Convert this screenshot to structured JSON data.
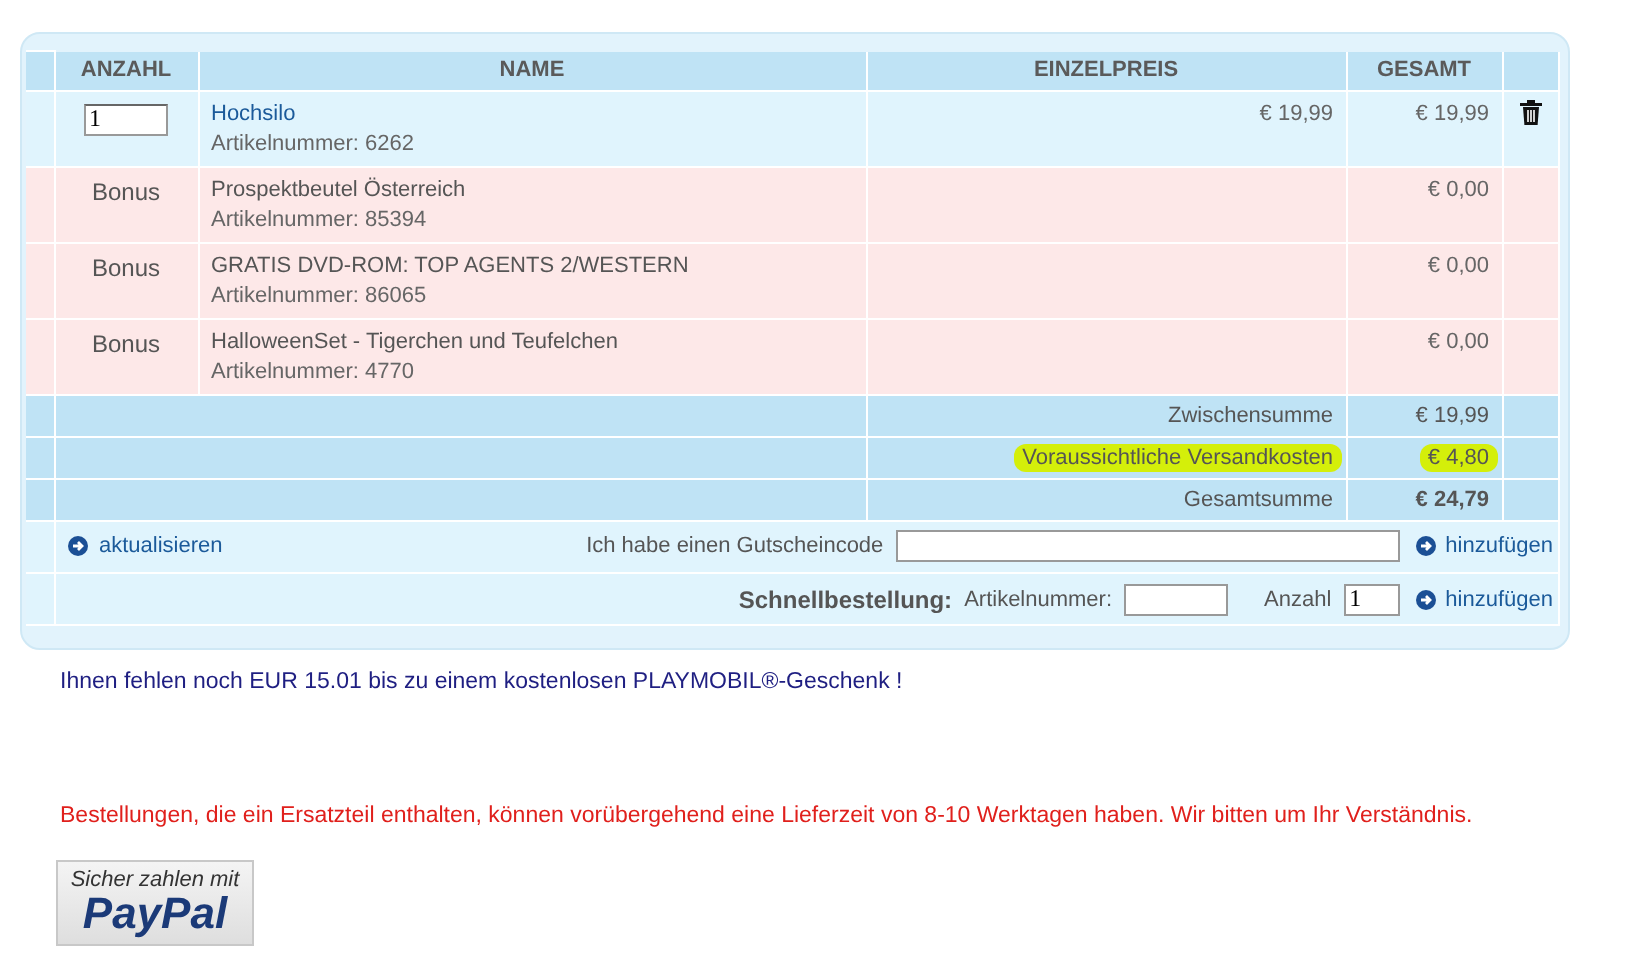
{
  "columns": [
    {
      "label": "ANZAHL"
    },
    {
      "label": "NAME"
    },
    {
      "label": "EINZELPREIS"
    },
    {
      "label": "GESAMT"
    }
  ],
  "items": [
    {
      "kind": "product",
      "quantity": "1",
      "name": "Hochsilo",
      "article": "Artikelnummer: 6262",
      "unit_price": "€ 19,99",
      "total": "€ 19,99"
    },
    {
      "kind": "bonus",
      "label": "Bonus",
      "name": "Prospektbeutel Österreich",
      "article": "Artikelnummer: 85394",
      "total": "€ 0,00"
    },
    {
      "kind": "bonus",
      "label": "Bonus",
      "name": "GRATIS DVD-ROM: TOP AGENTS 2/WESTERN",
      "article": "Artikelnummer: 86065",
      "total": "€ 0,00"
    },
    {
      "kind": "bonus",
      "label": "Bonus",
      "name": "HalloweenSet - Tigerchen und Teufelchen",
      "article": "Artikelnummer: 4770",
      "total": "€ 0,00"
    }
  ],
  "summary": [
    {
      "label": "Zwischensumme",
      "value": "€ 19,99",
      "highlighted": false,
      "emphasized": false
    },
    {
      "label": "Voraussichtliche Versandkosten",
      "value": "€ 4,80",
      "highlighted": true,
      "emphasized": false
    },
    {
      "label": "Gesamtsumme",
      "value": "€ 24,79",
      "highlighted": false,
      "emphasized": true
    }
  ],
  "update_link": "aktualisieren",
  "voucher": {
    "label": "Ich habe einen Gutscheincode",
    "add_link": "hinzufügen"
  },
  "quick_order": {
    "title": "Schnellbestellung:",
    "article_label": "Artikelnummer:",
    "quantity_label": "Anzahl",
    "quantity": "1",
    "add_link": "hinzufügen"
  },
  "gift_notice": "Ihnen fehlen noch EUR 15.01 bis zu einem kostenlosen PLAYMOBIL®-Geschenk !",
  "delivery_notice": "Bestellungen, die ein Ersatzteil enthalten, können vorübergehend eine Lieferzeit von 8-10 Werktagen haben. Wir bitten um Ihr Verständnis.",
  "paypal": {
    "caption": "Sicher zahlen mit",
    "logo": "PayPal"
  }
}
